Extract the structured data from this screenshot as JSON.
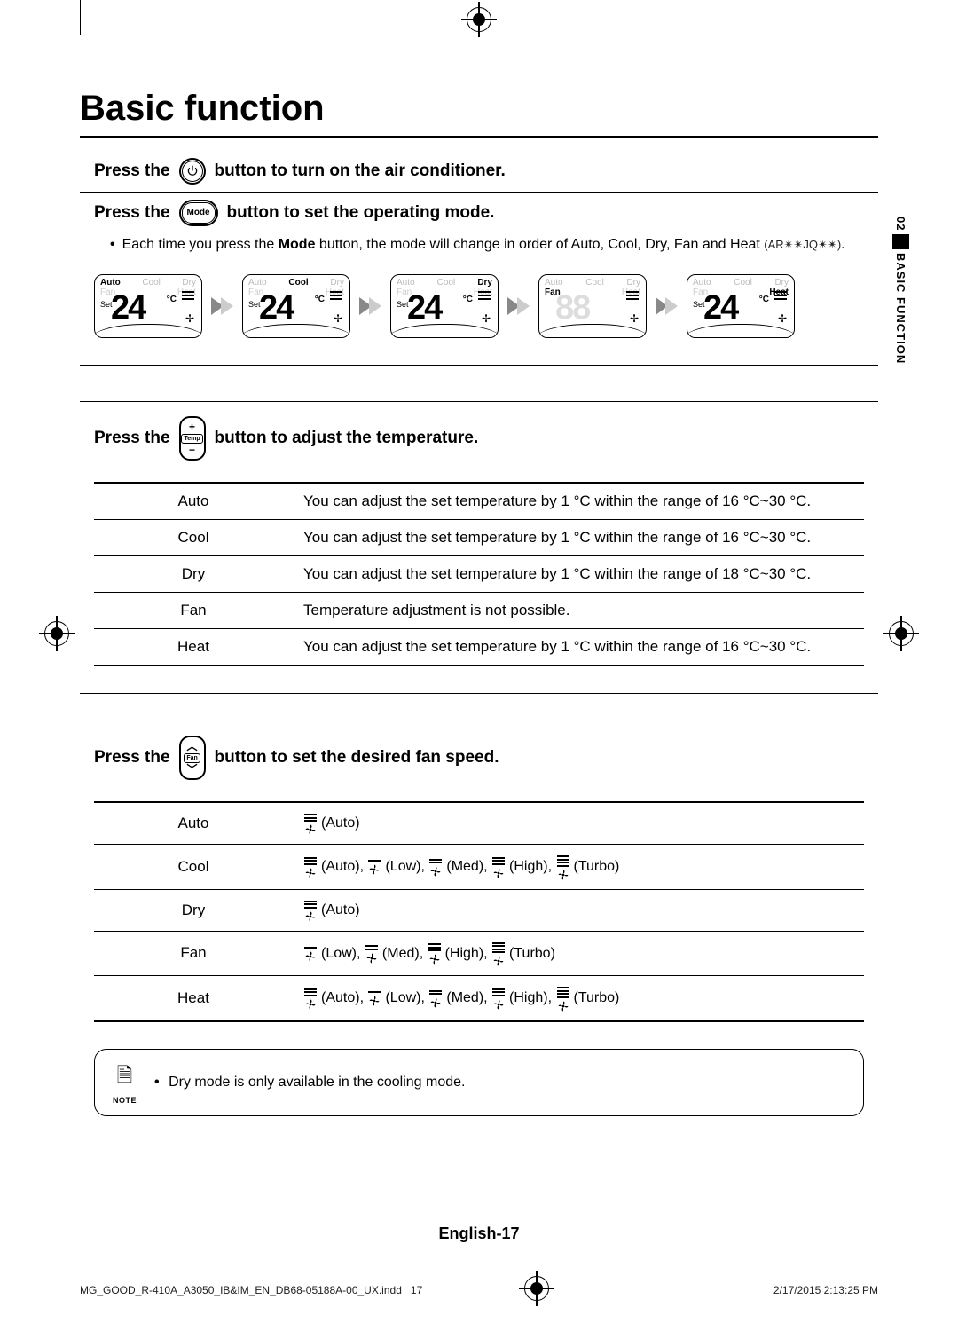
{
  "page_title": "Basic function",
  "side_tab": {
    "num": "02",
    "text": "BASIC FUNCTION"
  },
  "steps": {
    "power": {
      "lead": "Press the",
      "trail": "button to turn on the air conditioner."
    },
    "mode": {
      "lead": "Press the",
      "btn_label": "Mode",
      "trail": "button to set the operating mode."
    },
    "temp": {
      "lead": "Press the",
      "btn_top": "+",
      "btn_mid": "Temp",
      "btn_bot": "−",
      "trail": "button to adjust the temperature."
    },
    "fan": {
      "lead": "Press the",
      "btn_top": "︿",
      "btn_mid": "Fan",
      "btn_bot": "﹀",
      "trail": "button to set the desired fan speed."
    }
  },
  "mode_note": {
    "bullet": "•",
    "text_before": "Each time you press the ",
    "bold_word": "Mode",
    "text_after": " button, the mode will change in order of Auto, Cool, Dry, Fan and Heat ",
    "model_code": "(AR✴✴JQ✴✴)",
    "period": "."
  },
  "screens": {
    "set_label": "Set",
    "temp_value": "24",
    "deg_label": "°C",
    "modes_line": [
      "Auto",
      "Cool",
      "Dry"
    ],
    "line2": [
      "Fan",
      "Heat"
    ],
    "items": [
      {
        "active_mode": "Auto",
        "show_temp": true
      },
      {
        "active_mode": "Cool",
        "show_temp": true
      },
      {
        "active_mode": "Dry",
        "show_temp": true
      },
      {
        "active_mode": "Fan",
        "show_temp": false
      },
      {
        "active_mode": "Heat",
        "show_temp": true
      }
    ]
  },
  "temp_table": [
    {
      "mode": "Auto",
      "desc": "You can adjust the set temperature by 1 °C within the range of 16 °C~30 °C."
    },
    {
      "mode": "Cool",
      "desc": "You can adjust the set temperature by 1 °C within the range of 16 °C~30 °C."
    },
    {
      "mode": "Dry",
      "desc": "You can adjust the set temperature by 1 °C within the range of 18 °C~30 °C."
    },
    {
      "mode": "Fan",
      "desc": "Temperature adjustment is not possible."
    },
    {
      "mode": "Heat",
      "desc": "You can adjust the set temperature by 1 °C within the range of 16 °C~30 °C."
    }
  ],
  "fan_labels": {
    "auto": "(Auto)",
    "low": "(Low)",
    "med": "(Med)",
    "high": "(High)",
    "turbo": "(Turbo)"
  },
  "fan_table": [
    {
      "mode": "Auto",
      "speeds": [
        "auto"
      ]
    },
    {
      "mode": "Cool",
      "speeds": [
        "auto",
        "low",
        "med",
        "high",
        "turbo"
      ]
    },
    {
      "mode": "Dry",
      "speeds": [
        "auto"
      ]
    },
    {
      "mode": "Fan",
      "speeds": [
        "low",
        "med",
        "high",
        "turbo"
      ]
    },
    {
      "mode": "Heat",
      "speeds": [
        "auto",
        "low",
        "med",
        "high",
        "turbo"
      ]
    }
  ],
  "note": {
    "label": "NOTE",
    "bullet": "•",
    "text": "Dry mode is only available in the cooling mode."
  },
  "footer_page": "English-17",
  "print_footer": {
    "left_a": "MG_GOOD_R-410A_A3050_IB&IM_EN_DB68-05188A-00_UX.indd",
    "left_b": "17",
    "right": "2/17/2015   2:13:25 PM"
  }
}
